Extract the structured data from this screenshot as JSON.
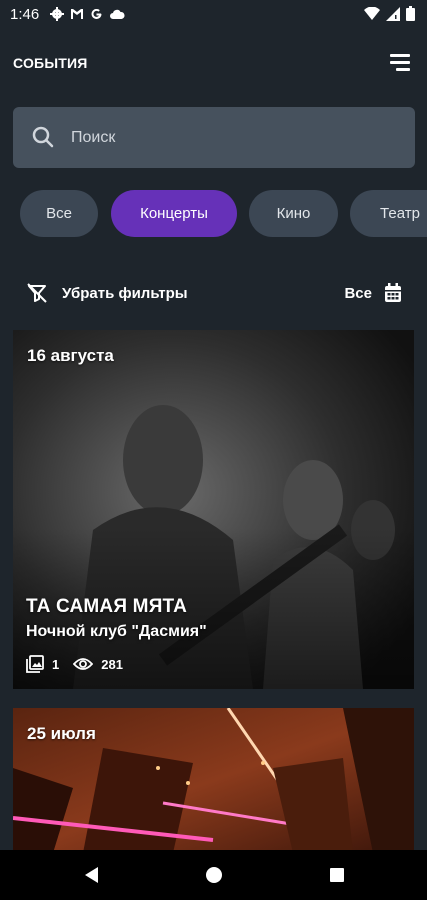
{
  "status_bar": {
    "time": "1:46",
    "left_icons": [
      "gear-icon",
      "gmail-icon",
      "google-icon",
      "cloud-icon"
    ],
    "right_icons": [
      "wifi-icon",
      "signal-icon",
      "battery-icon"
    ]
  },
  "header": {
    "title": "СОБЫТИЯ",
    "menu_icon": "menu-icon"
  },
  "search": {
    "placeholder": "Поиск",
    "value": ""
  },
  "categories": [
    {
      "label": "Все",
      "active": false
    },
    {
      "label": "Концерты",
      "active": true
    },
    {
      "label": "Кино",
      "active": false
    },
    {
      "label": "Театр",
      "active": false
    }
  ],
  "filters": {
    "clear_label": "Убрать фильтры",
    "date_label": "Все"
  },
  "events": [
    {
      "date": "16 августа",
      "title": "ТА САМАЯ МЯТА",
      "venue": "Ночной клуб \"Дасмия\"",
      "photos": "1",
      "views": "281"
    },
    {
      "date": "25 июля"
    }
  ],
  "nav": [
    "back-icon",
    "home-icon",
    "recents-icon"
  ],
  "colors": {
    "background": "#1e252c",
    "search_bg": "#46515d",
    "chip_bg": "#3c4754",
    "chip_active": "#6631b8"
  }
}
